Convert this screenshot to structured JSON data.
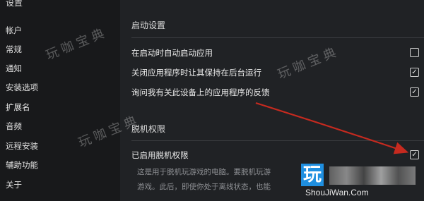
{
  "sidebar": {
    "title": "设置",
    "items": [
      {
        "label": "帐户"
      },
      {
        "label": "常规"
      },
      {
        "label": "通知"
      },
      {
        "label": "安装选项"
      },
      {
        "label": "扩展名"
      },
      {
        "label": "音频"
      },
      {
        "label": "远程安装"
      },
      {
        "label": "辅助功能"
      },
      {
        "label": "关于"
      }
    ]
  },
  "startup": {
    "title": "启动设置",
    "options": [
      {
        "label": "在启动时自动启动应用",
        "checked": false
      },
      {
        "label": "关闭应用程序时让其保持在后台运行",
        "checked": true
      },
      {
        "label": "询问我有关此设备上的应用程序的反馈",
        "checked": true
      }
    ]
  },
  "offline": {
    "title": "脱机权限",
    "option": {
      "label": "已启用脱机权限",
      "checked": true
    },
    "desc_line1": "这是用于脱机玩游戏的电脑。要脱机玩游",
    "desc_line2": "游戏。此后，即使你处于离线状态，也能"
  },
  "watermark": {
    "text": "玩咖宝典"
  },
  "logo": {
    "glyph": "玩",
    "site": "ShouJiWan.Com"
  },
  "colors": {
    "arrow": "#c62a1f",
    "logo": "#1f8fe0"
  }
}
